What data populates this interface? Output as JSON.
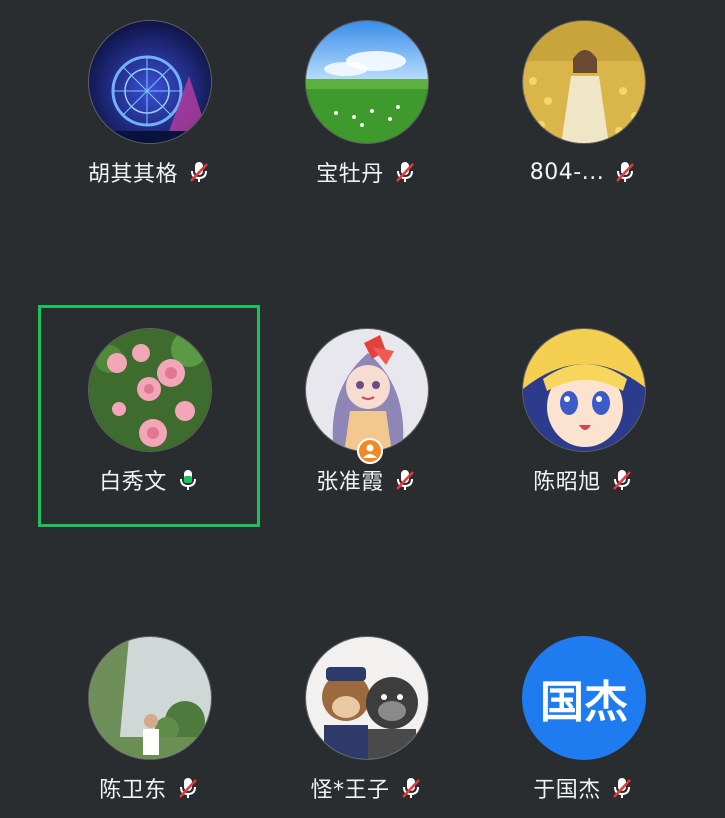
{
  "participants": [
    {
      "name": "胡其其格",
      "mic": "muted",
      "avatar": "ferris-wheel-night-photo"
    },
    {
      "name": "宝牡丹",
      "mic": "muted",
      "avatar": "grassland-sky-photo"
    },
    {
      "name": "804-...",
      "mic": "muted",
      "avatar": "girl-in-flower-field-photo"
    },
    {
      "name": "白秀文",
      "mic": "active",
      "avatar": "pink-peony-photo"
    },
    {
      "name": "张准霞",
      "mic": "muted",
      "avatar": "cartoon-girl-illustration",
      "badge": "host-person-icon"
    },
    {
      "name": "陈昭旭",
      "mic": "muted",
      "avatar": "anime-sailor-moon-face"
    },
    {
      "name": "陈卫东",
      "mic": "muted",
      "avatar": "man-in-park-photo"
    },
    {
      "name": "怪*王子",
      "mic": "muted",
      "avatar": "plush-monkey-toys-photo"
    },
    {
      "name": "于国杰",
      "mic": "muted",
      "avatar_text": "国杰"
    }
  ],
  "colors": {
    "background": "#2a2d2f",
    "active_speaker_border": "#19c25a",
    "mic_active": "#19c25a",
    "mic_muted_slash": "#e5383b",
    "text_avatar_bg": "#1f7cf0",
    "host_badge": "#f08a24"
  }
}
